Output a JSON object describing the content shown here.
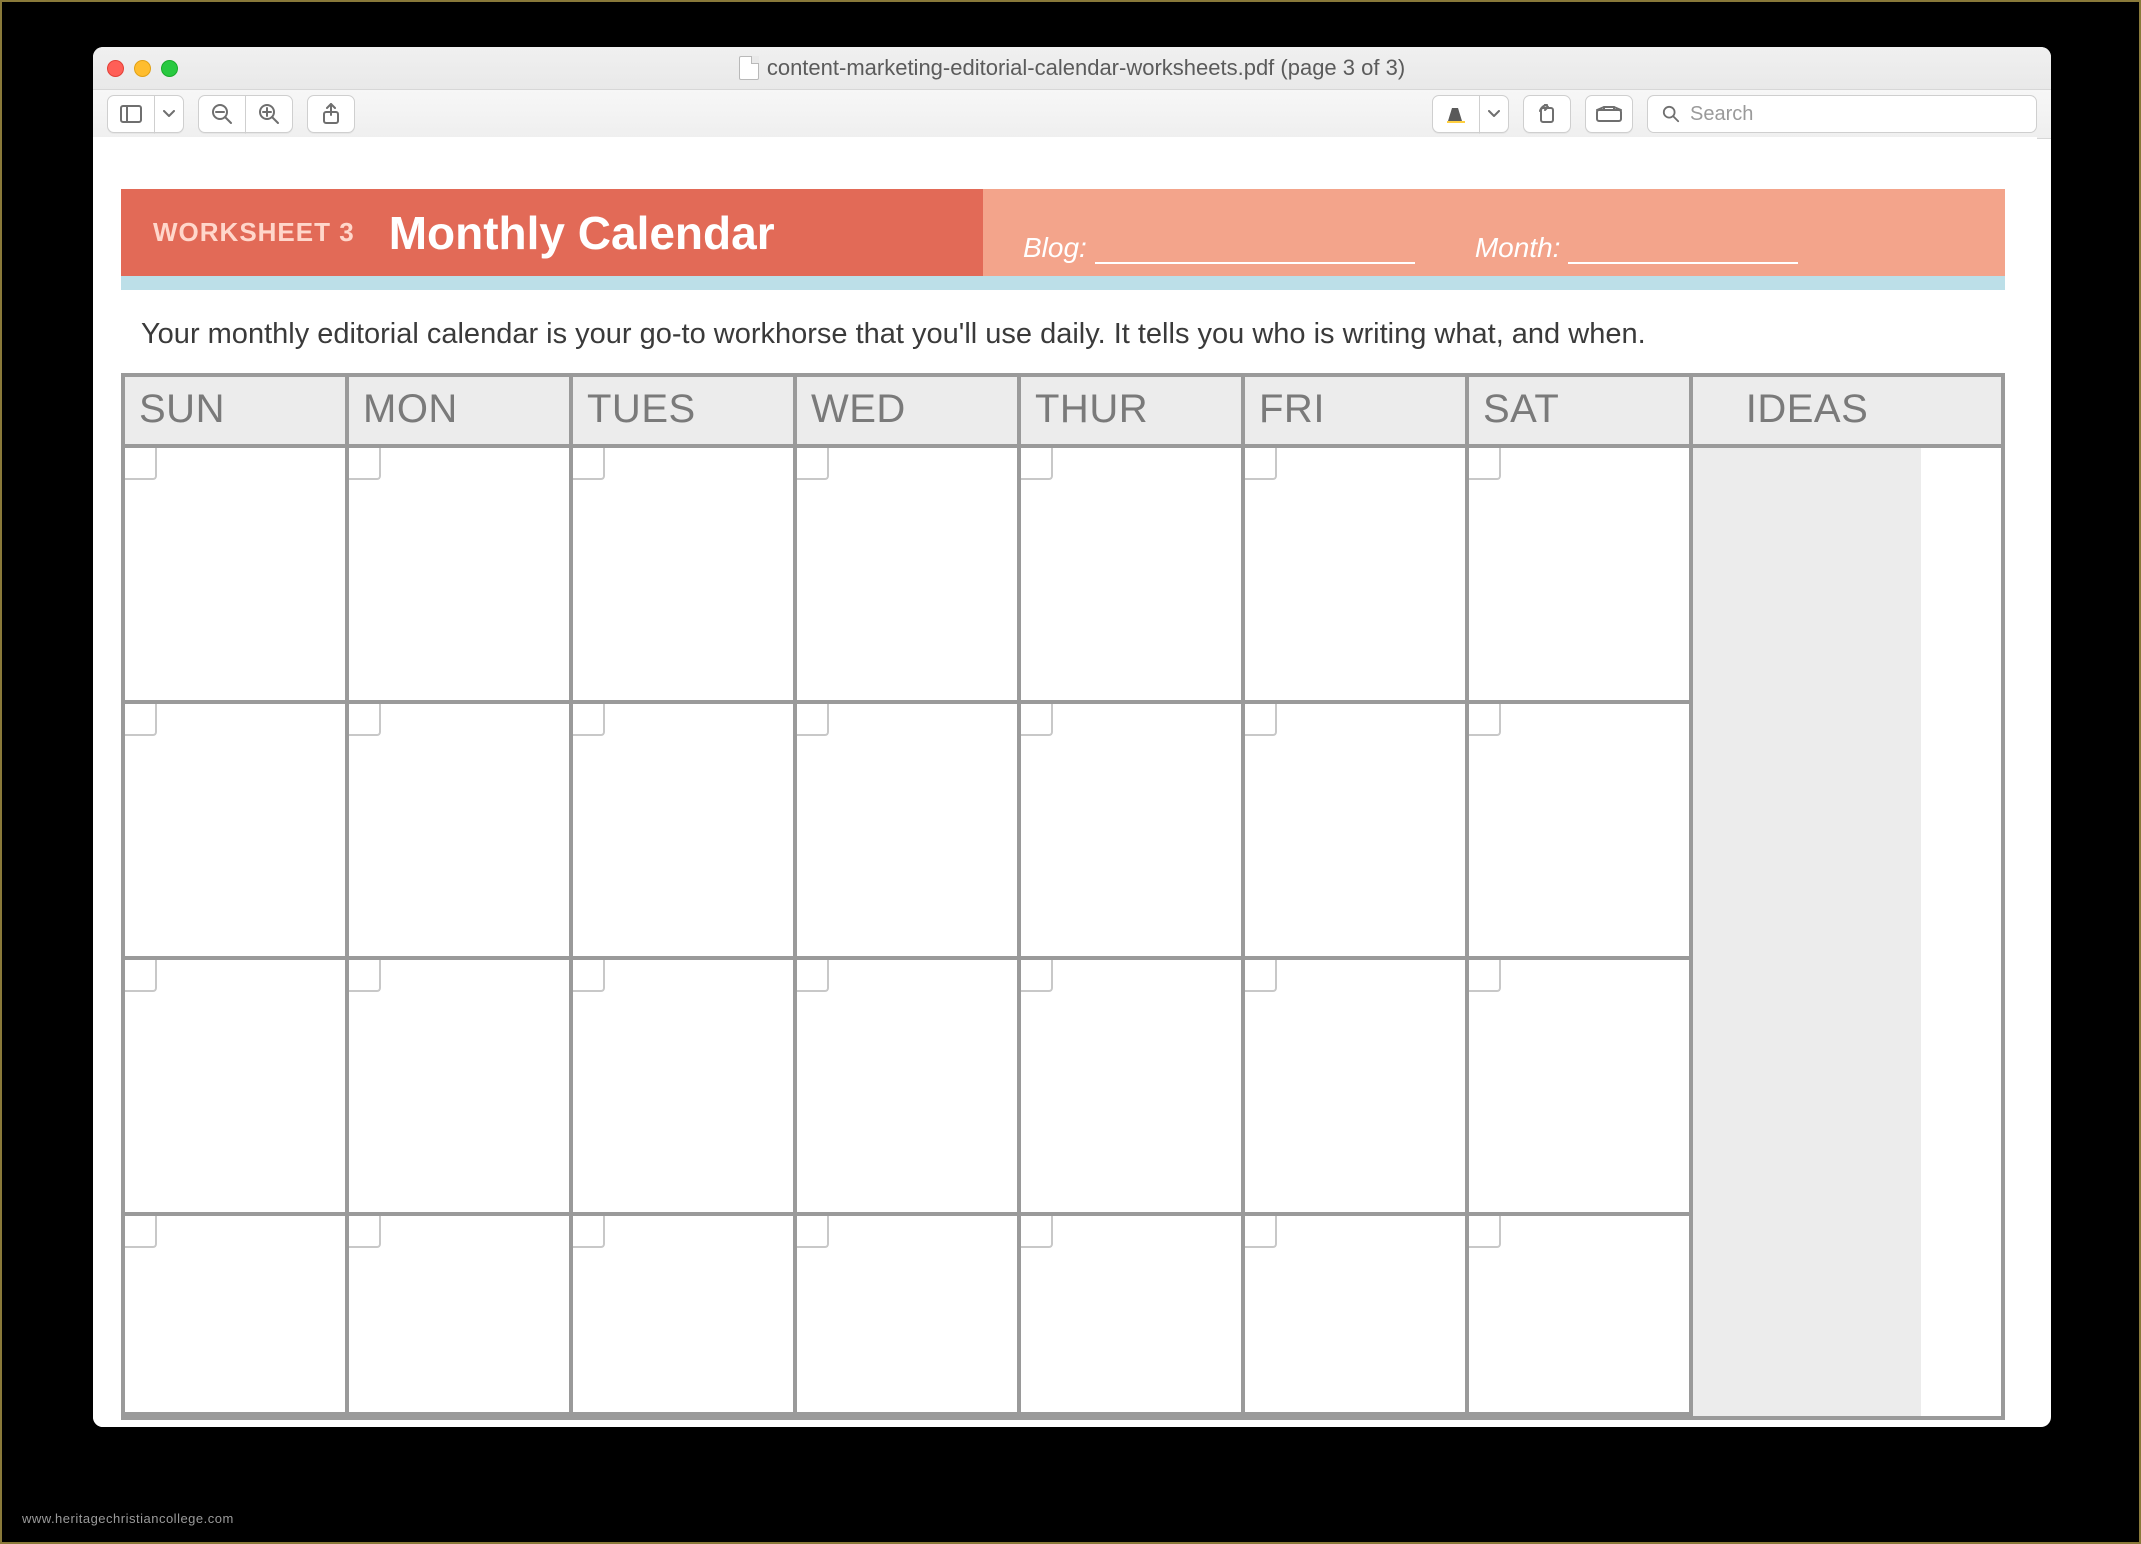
{
  "window": {
    "title": "content-marketing-editorial-calendar-worksheets.pdf (page 3 of 3)",
    "search_placeholder": "Search"
  },
  "worksheet": {
    "label": "WORKSHEET 3",
    "title": "Monthly Calendar",
    "blog_label": "Blog:",
    "month_label": "Month:",
    "intro": "Your monthly editorial calendar is your go-to workhorse that you'll use daily. It tells you who is writing what, and when."
  },
  "calendar": {
    "days": [
      "SUN",
      "MON",
      "TUES",
      "WED",
      "THUR",
      "FRI",
      "SAT"
    ],
    "ideas_label": "IDEAS",
    "rows": 4,
    "cols": 7
  },
  "watermark": "www.heritagechristiancollege.com"
}
